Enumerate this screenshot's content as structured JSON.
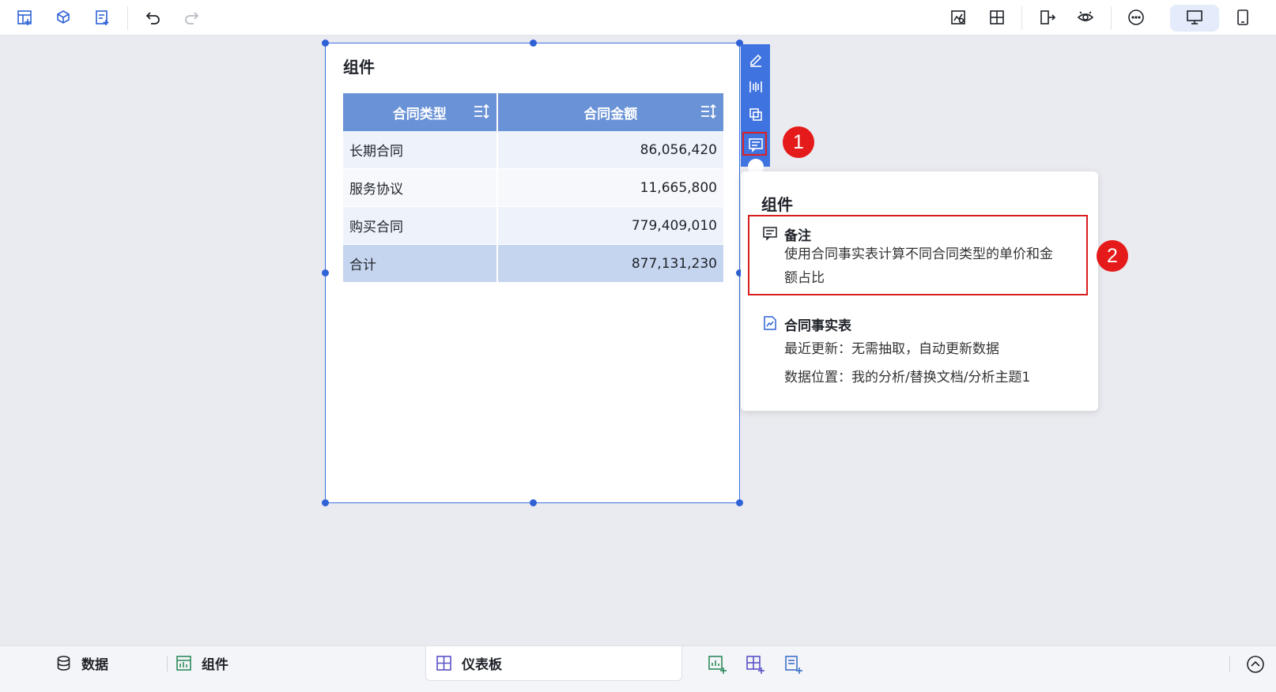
{
  "toolbar": {
    "left_icons": [
      "add-component-icon",
      "add-3d-icon",
      "add-text-icon",
      "undo-icon",
      "redo-icon"
    ],
    "right_icons": [
      "preview-chart-icon",
      "layout-icon",
      "export-icon",
      "eye-icon",
      "more-icon",
      "desktop-icon",
      "mobile-icon"
    ]
  },
  "widget": {
    "title": "组件",
    "columns": [
      "合同类型",
      "合同金额"
    ],
    "rows": [
      {
        "type": "长期合同",
        "amount": "86,056,420"
      },
      {
        "type": "服务协议",
        "amount": "11,665,800"
      },
      {
        "type": "购买合同",
        "amount": "779,409,010"
      }
    ],
    "total": {
      "label": "合计",
      "amount": "877,131,230"
    }
  },
  "side_tools": [
    "edit-icon",
    "filter-icon",
    "copy-icon",
    "comment-icon"
  ],
  "badges": {
    "one": "1",
    "two": "2"
  },
  "popover": {
    "title": "组件",
    "note_title": "备注",
    "note_text_1": "使用合同事实表计算不同合同类型的单价和金",
    "note_text_2": "额占比",
    "source_title": "合同事实表",
    "last_update": "最近更新：无需抽取，自动更新数据",
    "location": "数据位置：我的分析/替换文档/分析主题1"
  },
  "bottom": {
    "data_tab": "数据",
    "component_tab": "组件",
    "dashboard_tab": "仪表板"
  },
  "colors": {
    "accent": "#3f73df",
    "header": "#6a92d6",
    "highlight": "#e51a1a"
  }
}
